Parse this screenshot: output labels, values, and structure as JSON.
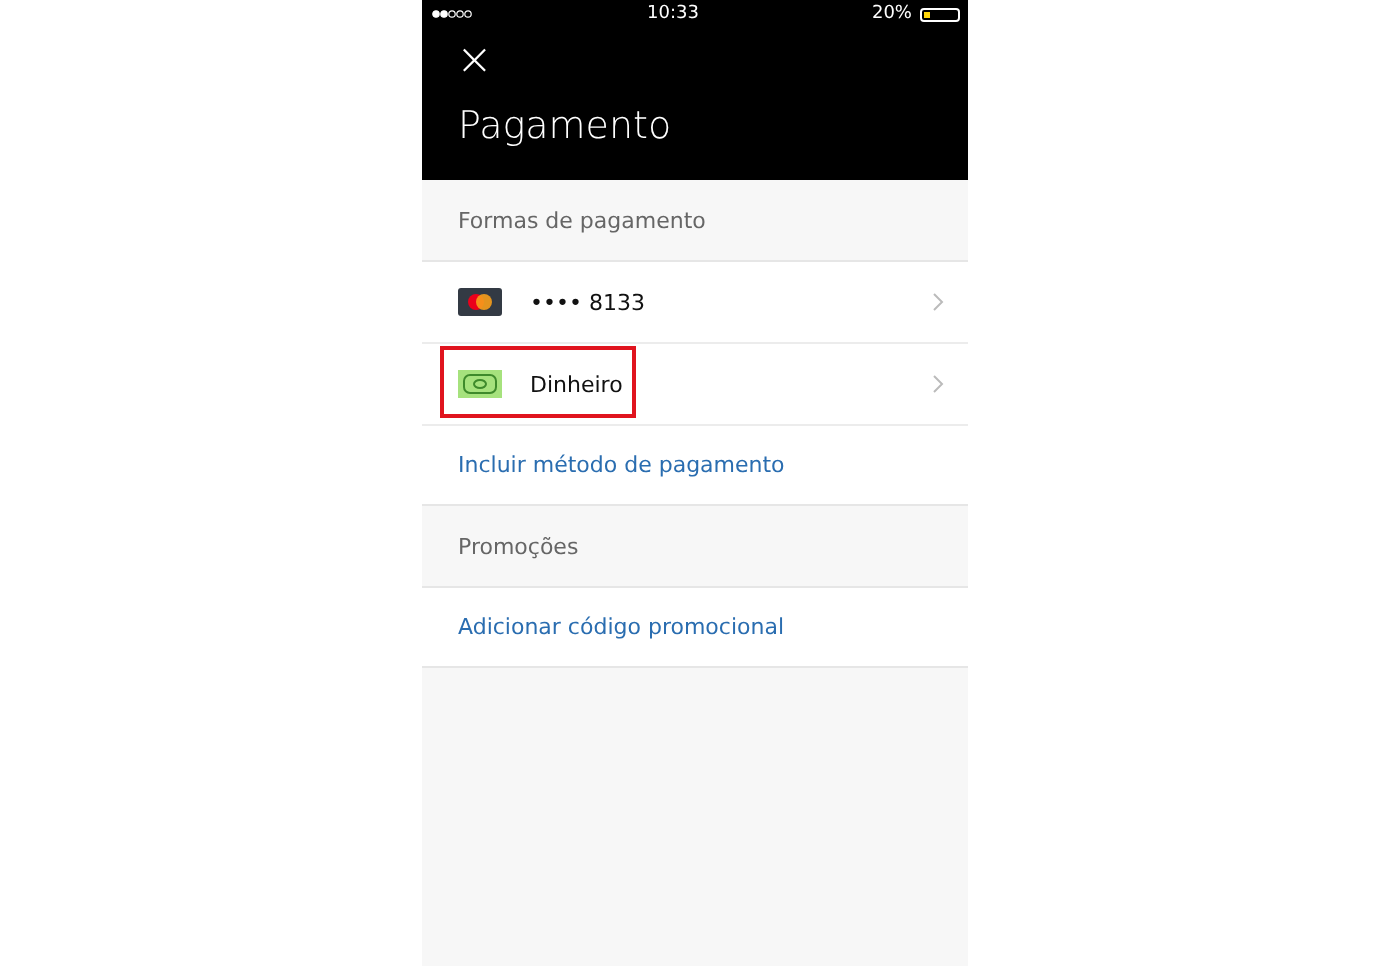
{
  "status_bar": {
    "time": "10:33",
    "battery": "20%"
  },
  "header": {
    "close": "×",
    "title": "Pagamento"
  },
  "sections": [
    {
      "title": "Formas de pagamento",
      "items": [
        {
          "kind": "card",
          "label": "•••• 8133",
          "highlighted": false
        },
        {
          "kind": "cash",
          "label": "Dinheiro",
          "highlighted": true
        }
      ],
      "link": "Incluir método de pagamento"
    },
    {
      "title": "Promoções",
      "link": "Adicionar código promocional"
    }
  ]
}
